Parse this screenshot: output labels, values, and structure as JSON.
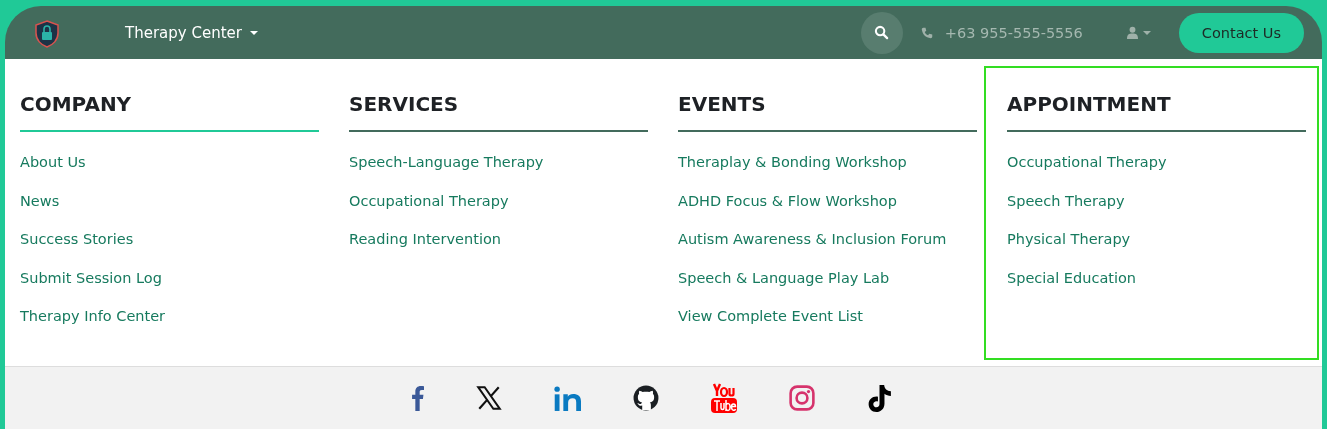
{
  "header": {
    "brand_menu": "Therapy Center",
    "phone": "+63 955-555-5556",
    "contact_button": "Contact Us"
  },
  "menu_columns": [
    {
      "title": "COMPANY",
      "selected": true,
      "focused": false,
      "links": [
        "About Us",
        "News",
        "Success Stories",
        "Submit Session Log",
        "Therapy Info Center"
      ]
    },
    {
      "title": "SERVICES",
      "selected": false,
      "focused": false,
      "links": [
        "Speech-Language Therapy",
        "Occupational Therapy",
        "Reading Intervention"
      ]
    },
    {
      "title": "EVENTS",
      "selected": false,
      "focused": false,
      "links": [
        "Theraplay & Bonding Workshop",
        "ADHD Focus & Flow Workshop",
        "Autism Awareness & Inclusion Forum",
        "Speech & Language Play Lab",
        "View Complete Event List"
      ]
    },
    {
      "title": "APPOINTMENT",
      "selected": false,
      "focused": true,
      "links": [
        "Occupational Therapy",
        "Speech Therapy",
        "Physical Therapy",
        "Special Education"
      ]
    }
  ],
  "social_links": [
    {
      "kind": "facebook"
    },
    {
      "kind": "x"
    },
    {
      "kind": "linkedin"
    },
    {
      "kind": "github"
    },
    {
      "kind": "youtube"
    },
    {
      "kind": "instagram"
    },
    {
      "kind": "tiktok"
    }
  ]
}
